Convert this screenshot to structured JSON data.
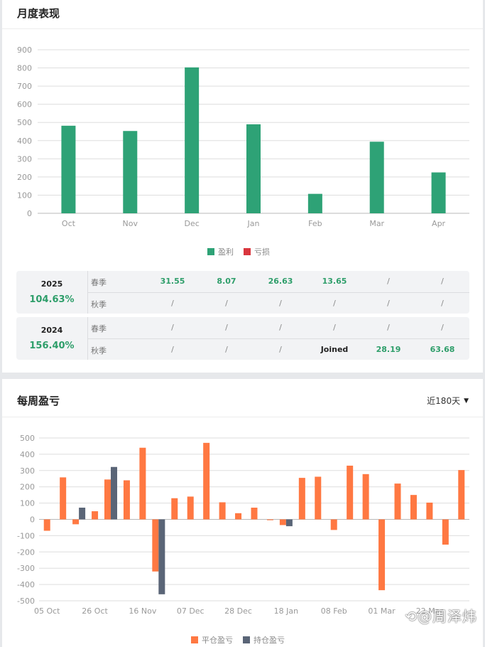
{
  "monthly": {
    "title": "月度表现",
    "colors": {
      "profit": "#2ea276",
      "loss": "#d9363e"
    },
    "legend": [
      {
        "label": "盈利",
        "color": "#2ea276"
      },
      {
        "label": "亏损",
        "color": "#d9363e"
      }
    ]
  },
  "chart_data": [
    {
      "type": "bar",
      "categories": [
        "Oct",
        "Nov",
        "Dec",
        "Jan",
        "Feb",
        "Mar",
        "Apr"
      ],
      "values": [
        482,
        453,
        803,
        490,
        107,
        394,
        225
      ],
      "ylim": [
        0,
        900
      ],
      "yticks": [
        0,
        100,
        200,
        300,
        400,
        500,
        600,
        700,
        800,
        900
      ],
      "grid": true,
      "legend_placement": "bottom-center"
    },
    {
      "type": "bar",
      "x_tick_labels": [
        "05 Oct",
        "26 Oct",
        "16 Nov",
        "07 Dec",
        "28 Dec",
        "18 Jan",
        "08 Feb",
        "01 Mar",
        "22 Mar"
      ],
      "series": [
        {
          "name": "平仓盈亏",
          "values": [
            -70,
            258,
            -30,
            50,
            245,
            240,
            440,
            -320,
            130,
            140,
            470,
            105,
            38,
            72,
            -5,
            -35,
            255,
            262,
            -65,
            330,
            278,
            -435,
            220,
            150,
            103,
            -155,
            303
          ]
        },
        {
          "name": "持仓盈亏",
          "values": [
            null,
            null,
            72,
            null,
            322,
            null,
            null,
            -460,
            null,
            null,
            null,
            null,
            null,
            null,
            null,
            -42,
            null,
            null,
            null,
            null,
            null,
            null,
            null,
            null,
            null,
            null,
            null
          ]
        }
      ],
      "ylim": [
        -500,
        500
      ],
      "yticks": [
        -500,
        -400,
        -300,
        -200,
        -100,
        0,
        100,
        200,
        300,
        400,
        500
      ],
      "grid": true,
      "legend_placement": "bottom-center"
    }
  ],
  "years": [
    {
      "year": "2025",
      "pct": "104.63%",
      "rows": [
        {
          "season": "春季",
          "cells": [
            "31.55",
            "8.07",
            "26.63",
            "13.65",
            "/",
            "/"
          ]
        },
        {
          "season": "秋季",
          "cells": [
            "/",
            "/",
            "/",
            "/",
            "/",
            "/"
          ]
        }
      ]
    },
    {
      "year": "2024",
      "pct": "156.40%",
      "rows": [
        {
          "season": "春季",
          "cells": [
            "/",
            "/",
            "/",
            "/",
            "/",
            "/"
          ]
        },
        {
          "season": "秋季",
          "cells": [
            "/",
            "/",
            "/",
            "Joined",
            "28.19",
            "63.68"
          ]
        }
      ]
    }
  ],
  "weekly": {
    "title": "每周盈亏",
    "range": "近180天",
    "colors": {
      "closed": "#ff7842",
      "open": "#5a6577"
    },
    "legend": [
      {
        "label": "平仓盈亏",
        "color": "#ff7842"
      },
      {
        "label": "持仓盈亏",
        "color": "#5a6577"
      }
    ]
  },
  "watermark": "@周泽炜",
  "icons": {
    "dropdown": "caret-down-icon",
    "watermark_logo": "weibo-logo-icon"
  }
}
